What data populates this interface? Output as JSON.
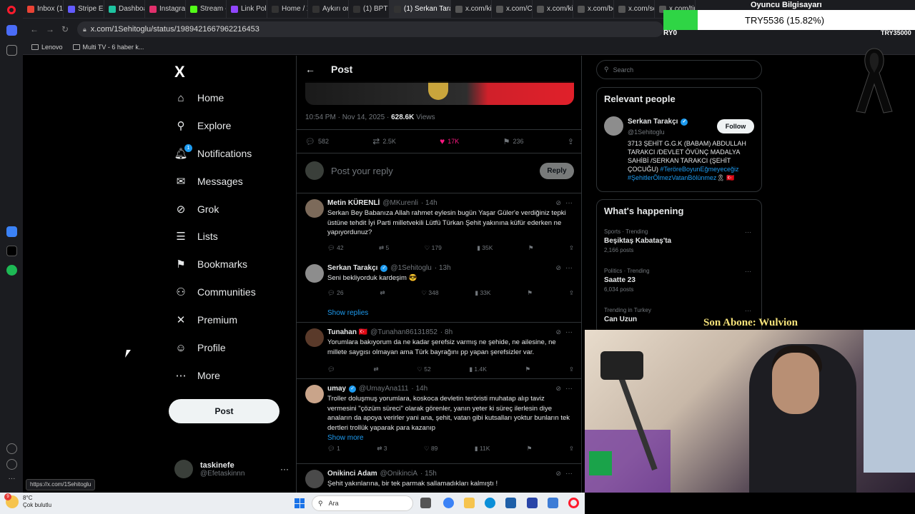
{
  "browser": {
    "tabs": [
      {
        "label": "Inbox (1,0",
        "color": "#ea4335"
      },
      {
        "label": "Stripe Expr",
        "color": "#635bff"
      },
      {
        "label": "Dashboard",
        "color": "#1ec3a0"
      },
      {
        "label": "Instagram",
        "color": "#e1306c"
      },
      {
        "label": "Stream - K",
        "color": "#53fc18"
      },
      {
        "label": "Link Polisi",
        "color": "#9146ff"
      },
      {
        "label": "Home / X",
        "color": "#333333"
      },
      {
        "label": "Aykırı on X",
        "color": "#333333"
      },
      {
        "label": "(1) BPT on",
        "color": "#333333"
      },
      {
        "label": "(1) Serkan Tarakçı",
        "color": "#333333",
        "active": true
      },
      {
        "label": "x.com/kiye",
        "color": "#555555"
      },
      {
        "label": "x.com/Con",
        "color": "#555555"
      },
      {
        "label": "x.com/kiye",
        "color": "#555555"
      },
      {
        "label": "x.com/bos",
        "color": "#555555"
      },
      {
        "label": "x.com/sol",
        "color": "#555555"
      },
      {
        "label": "x.com/tim",
        "color": "#555555"
      }
    ],
    "url": "x.com/1Sehitoglu/status/1989421667962216453",
    "bookmarks": [
      "Lenovo",
      "Multi TV - 6 haber k..."
    ],
    "status_url": "https://x.com/1Sehitoglu"
  },
  "overlay": {
    "donation_goal": "TRY5536 (15.82%)",
    "goal_left": "RY0",
    "goal_right": "TRY35000",
    "title": "Oyuncu Bilgisayarı",
    "last_sub": "Son Abone: Wulvion"
  },
  "nav": {
    "logo": "X",
    "items": [
      {
        "label": "Home",
        "icon": "home-icon",
        "glyph": "⌂"
      },
      {
        "label": "Explore",
        "icon": "search-icon",
        "glyph": "⚲"
      },
      {
        "label": "Notifications",
        "icon": "bell-icon",
        "glyph": "🔔︎",
        "badge": "1"
      },
      {
        "label": "Messages",
        "icon": "mail-icon",
        "glyph": "✉"
      },
      {
        "label": "Grok",
        "icon": "grok-icon",
        "glyph": "⊘"
      },
      {
        "label": "Lists",
        "icon": "list-icon",
        "glyph": "☰"
      },
      {
        "label": "Bookmarks",
        "icon": "bookmark-icon",
        "glyph": "⚑"
      },
      {
        "label": "Communities",
        "icon": "communities-icon",
        "glyph": "⚇"
      },
      {
        "label": "Premium",
        "icon": "x-premium-icon",
        "glyph": "✕"
      },
      {
        "label": "Profile",
        "icon": "profile-icon",
        "glyph": "☺"
      },
      {
        "label": "More",
        "icon": "more-circle-icon",
        "glyph": "⋯"
      }
    ],
    "post_button": "Post",
    "account": {
      "name": "taskinefe",
      "handle": "@Efetaskinnn",
      "menu": "···"
    }
  },
  "main": {
    "header_title": "Post",
    "meta": {
      "time": "10:54 PM · Nov 14, 2025 · ",
      "views_count": "628.6K",
      "views_label": " Views"
    },
    "actions": {
      "replies": "582",
      "reposts": "2.5K",
      "likes": "17K",
      "bookmarks": "236"
    },
    "reply_placeholder": "Post your reply",
    "reply_button": "Reply",
    "tweets": [
      {
        "name": "Metin KÜRENLİ",
        "handle": "@MKurenli",
        "time": "· 14h",
        "verified": false,
        "text": "Serkan Bey Babanıza Allah rahmet eylesin bugün Yaşar Güler'e verdiğiniz tepki üstüne tehdit İyi Parti milletvekili Lütfü Türkan Şehit yakınına küfür ederken ne yapıyordunuz?",
        "replies": "42",
        "reposts": "5",
        "likes": "179",
        "views": "35K"
      },
      {
        "name": "Serkan Tarakçı",
        "handle": "@1Sehitoglu",
        "time": "· 13h",
        "verified": true,
        "text": "Seni bekliyorduk kardeşim 😎",
        "replies": "26",
        "reposts": "",
        "likes": "348",
        "views": "33K",
        "show_link": "Show replies"
      },
      {
        "name": "Tunahan 🇹🇷",
        "handle": "@Tunahan86131852",
        "time": "· 8h",
        "verified": false,
        "text": "Yorumlara bakıyorum da ne kadar şerefsiz varmış ne şehide, ne ailesine, ne millete saygısı olmayan ama Türk bayrağını pp yapan şerefsizler var.",
        "replies": "",
        "reposts": "",
        "likes": "52",
        "views": "1.4K"
      },
      {
        "name": "umay",
        "handle": "@UmayAna111",
        "time": "· 14h",
        "verified": true,
        "text": "Troller doluşmuş yorumlara, koskoca devletin teröristi muhatap alıp taviz vermesini \"çözüm süreci\" olarak görenler, yanın yeter ki süreç ilerlesin diye anaların da apoya verirler yani ana, şehit, vatan gibi kutsalları yoktur bunların tek dertleri trollük yaparak para kazanıp",
        "replies": "1",
        "reposts": "3",
        "likes": "89",
        "views": "11K",
        "show_link": "Show more"
      },
      {
        "name": "Onikinci Adam",
        "handle": "@OnikinciA",
        "time": "· 15h",
        "verified": false,
        "text": "Şehit yakınlarına, bir tek parmak sallamadıkları kalmıştı !",
        "replies": "",
        "reposts": "",
        "likes": "",
        "views": ""
      }
    ]
  },
  "sidebar": {
    "search_placeholder": "Search",
    "relevant_title": "Relevant people",
    "person": {
      "name": "Serkan Tarakçı",
      "handle": "@1Sehitoglu",
      "follow": "Follow",
      "bio": "3713 ŞEHİT G.G.K (BABAM) ABDULLAH TARAKCI /DEVLET ÖVÜNÇ MADALYA SAHİBİ /SERKAN TARAKCI (ŞEHİT ÇOCUĞU) ",
      "tag1": "#TeröreBoyunEğmeyeceğiz",
      "tag2": "#ŞehitlerÖlmezVatanBölünmez",
      "bio_end": "🎗 🇹🇷"
    },
    "happening_title": "What's happening",
    "trends": [
      {
        "context": "Sports · Trending",
        "title": "Beşiktaş Kabataş'ta",
        "count": "2,166 posts"
      },
      {
        "context": "Politics · Trending",
        "title": "Saatte 23",
        "count": "6,034 posts"
      },
      {
        "context": "Trending in Turkey",
        "title": "Can Uzun",
        "count": ""
      }
    ]
  },
  "taskbar": {
    "temp": "8°C",
    "weather": "Çok bulutlu",
    "weather_badge": "9",
    "search": "Ara"
  }
}
